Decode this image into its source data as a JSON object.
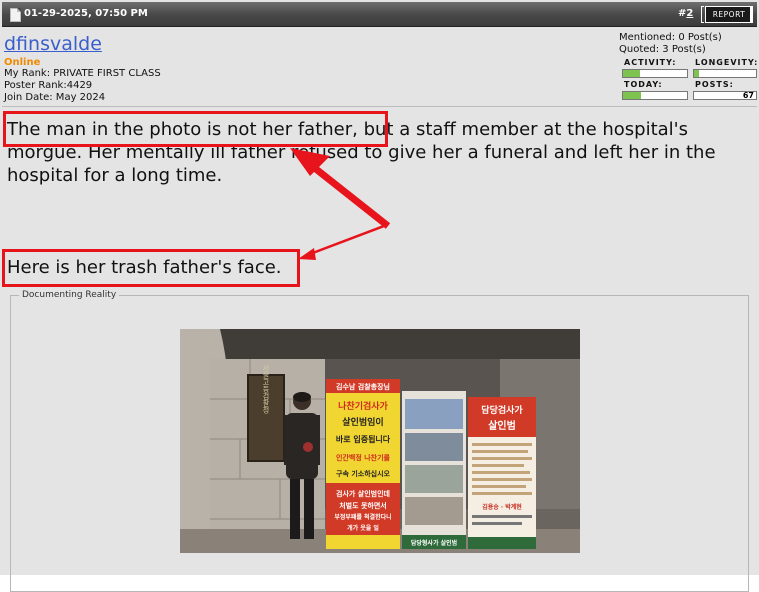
{
  "header": {
    "date": "01-29-2025, 07:50 PM",
    "post_hash": "#",
    "post_number": "2",
    "report_label": "REPORT"
  },
  "user": {
    "name": "dfinsvalde",
    "status": "Online",
    "rank": "My Rank: PRIVATE FIRST CLASS",
    "poster_rank": "Poster Rank:4429",
    "join_date": "Join Date: May 2024"
  },
  "stats": {
    "mentioned": "Mentioned: 0 Post(s)",
    "quoted": "Quoted: 3 Post(s)",
    "activity_label": "ACTIVITY:",
    "longevity_label": "LONGEVITY:",
    "today_label": "TODAY:",
    "posts_label": "POSTS:",
    "posts_count": "67",
    "activity_level": 0.27,
    "longevity_level": 0.08,
    "today_level": 0.28,
    "bar_color": "#7ec34f"
  },
  "post": {
    "paragraph1": "The man in the photo is not her father, but a staff member at the hospital's morgue. Her mentally ill father refused to give her a funeral and left her in the hospital for a long time.",
    "paragraph2": "Here is her trash father's face."
  },
  "fieldset": {
    "legend": "Documenting Reality"
  },
  "photo": {
    "sign_left_header": "김수남 검찰총장님",
    "sign_left_line1": "나찬기검사가",
    "sign_left_line2": "살인범임이",
    "sign_left_line3": "바로 입증됩니다",
    "sign_left_line4": "인간백정 나찬기를",
    "sign_left_line5": "구속 기소하십시오",
    "sign_left_line6": "검사가 살인범인데",
    "sign_left_line7": "처벌도 못하면서",
    "sign_left_line8": "부정부패를 척결한다니",
    "sign_left_line9": "개가 웃을 일",
    "sign_center_footer": "담당형사가 살인범",
    "sign_right_title1": "담당검사가",
    "sign_right_title2": "살인범",
    "sign_right_name": "김용승 · 박계현",
    "pillar_text": "서울고등검찰청"
  },
  "colors": {
    "highlight": "#e8141c",
    "link": "#3a5fcd",
    "online": "#f08a00"
  }
}
